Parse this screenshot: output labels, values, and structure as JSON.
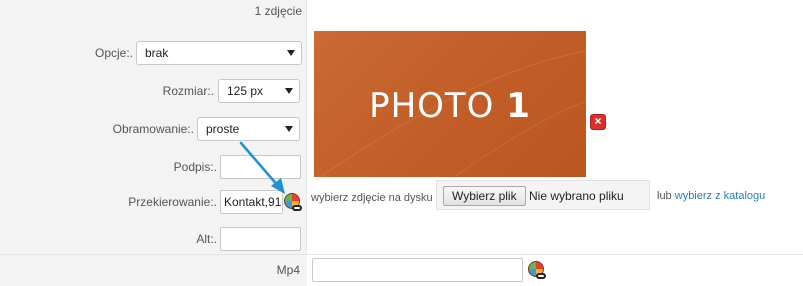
{
  "photo_count": "1 zdjęcie",
  "fields": {
    "opcje": {
      "label": "Opcje:.",
      "value": "brak"
    },
    "rozmiar": {
      "label": "Rozmiar:.",
      "value": "125 px"
    },
    "obramowanie": {
      "label": "Obramowanie:.",
      "value": "proste"
    },
    "podpis": {
      "label": "Podpis:.",
      "value": ""
    },
    "przekierowanie": {
      "label": "Przekierowanie:.",
      "value": "Kontakt,91"
    },
    "alt": {
      "label": "Alt:.",
      "value": ""
    }
  },
  "photo": {
    "word": "PHOTO",
    "number": "1"
  },
  "upload": {
    "hint": "wybierz zdjęcie na dysku",
    "button": "Wybierz plik",
    "status": "Nie wybrano pliku",
    "or": "lub",
    "catalog_link": "wybierz z katalogu"
  },
  "mp4": {
    "label": "Mp4",
    "value": ""
  },
  "colors": {
    "panel_bg": "#f3f3f3",
    "photo_orange": "#c4622d",
    "link_blue": "#2a7dc0",
    "delete_red": "#d9302e",
    "arrow_blue": "#1f8fd6"
  },
  "icons": [
    "delete-icon",
    "color-picker-link-icon",
    "annotation-arrow"
  ]
}
